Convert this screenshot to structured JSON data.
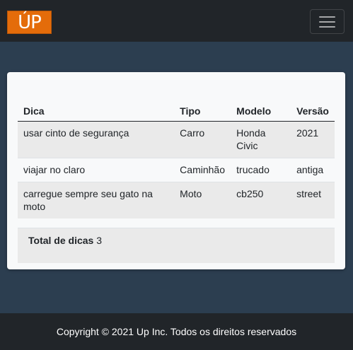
{
  "navbar": {
    "logo_text": "ÚP",
    "brand_color": "#e46c0a",
    "toggler_icon": "hamburger-menu-icon"
  },
  "table": {
    "headers": [
      "Dica",
      "Tipo",
      "Modelo",
      "Versão"
    ],
    "rows": [
      {
        "dica": "usar cinto de segurança",
        "tipo": "Carro",
        "modelo": "Honda Civic",
        "versao": "2021"
      },
      {
        "dica": "viajar no claro",
        "tipo": "Caminhão",
        "modelo": "trucado",
        "versao": "antiga"
      },
      {
        "dica": "carregue sempre seu gato na moto",
        "tipo": "Moto",
        "modelo": "cb250",
        "versao": "street"
      }
    ]
  },
  "summary": {
    "total_label": "Total de dicas",
    "total_value": "3"
  },
  "footer": {
    "text": "Copyright © 2021 Up Inc. Todos os direitos reservados"
  }
}
